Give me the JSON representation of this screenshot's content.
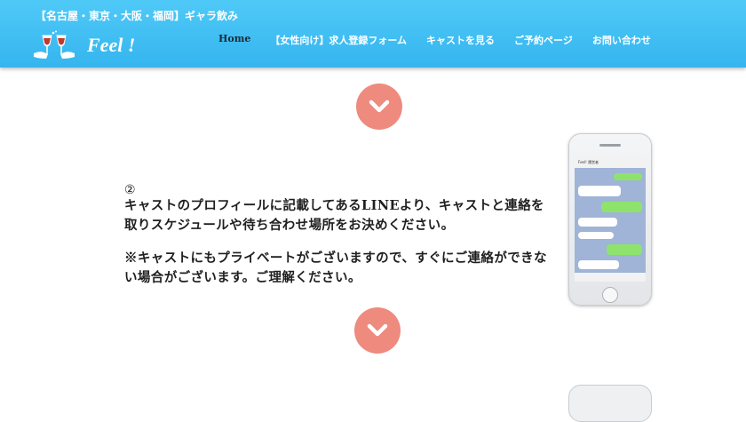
{
  "header": {
    "tagline": "【名古屋・東京・大阪・福岡】ギャラ飲み",
    "logo_text": "Feel !",
    "nav": [
      {
        "label": "Home"
      },
      {
        "label": "【女性向け】求人登録フォーム"
      },
      {
        "label": "キャストを見る"
      },
      {
        "label": "ご予約ページ"
      },
      {
        "label": "お問い合わせ"
      }
    ]
  },
  "content": {
    "step_number": "②",
    "paragraph1": "キャストのプロフィールに記載してあるLINEより、キャストと連絡を取りスケジュールや待ち合わせ場所をお決めください。",
    "paragraph2": "※キャストにもプライベートがございますので、すぐにご連絡ができない場合がございます。ご理解ください。"
  },
  "phone": {
    "chat_title": "Feel! 運営者"
  },
  "colors": {
    "header_bg": "#3bbbf2",
    "arrow_circle": "#ee8a7e",
    "text": "#1f1f1f"
  },
  "icons": [
    "wine-glasses-logo-icon",
    "chevron-down-icon",
    "smartphone-icon"
  ]
}
